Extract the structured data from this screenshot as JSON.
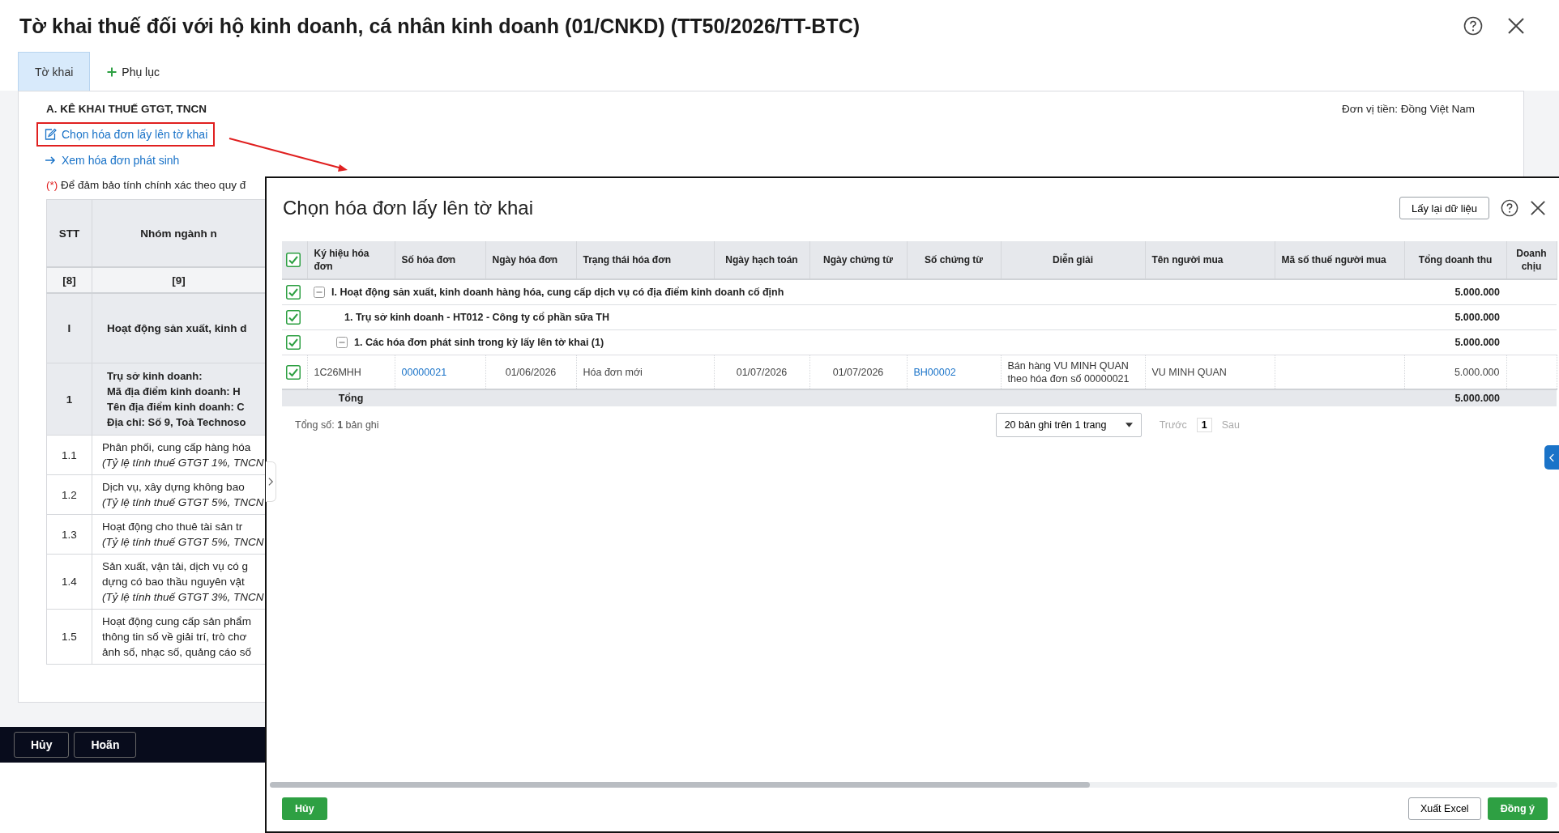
{
  "window": {
    "title": "Tờ khai thuế đối với hộ kinh doanh, cá nhân kinh doanh (01/CNKD) (TT50/2026/TT-BTC)"
  },
  "tabs": [
    {
      "label": "Tờ khai",
      "selected": true,
      "kind": "plain"
    },
    {
      "label": "Phụ lục",
      "selected": false,
      "kind": "add"
    }
  ],
  "section": {
    "heading": "A. KÊ KHAI THUẾ GTGT, TNCN",
    "currency": "Đơn vị tiền: Đồng Việt Nam",
    "links": [
      {
        "label": "Chọn hóa đơn lấy lên tờ khai",
        "kind": "edit",
        "highlighted": true
      },
      {
        "label": "Xem hóa đơn phát sinh",
        "kind": "arrow",
        "highlighted": false
      }
    ],
    "note_mark": "(*)",
    "note": "Để đảm bảo tính chính xác theo quy đ"
  },
  "declaration_table": {
    "columns": [
      "STT",
      "Nhóm ngành n"
    ],
    "index_row": [
      "[8]",
      "[9]"
    ],
    "rows": [
      {
        "kind": "group",
        "stt": "I",
        "lines": [
          "Hoạt động sản xuất, kinh d"
        ]
      },
      {
        "kind": "site",
        "stt": "1",
        "lines": [
          "Trụ sở kinh doanh:",
          "Mã địa điểm kinh doanh: H",
          "Tên địa điểm kinh doanh: C",
          "Địa chỉ: Số 9, Toà Technoso"
        ]
      },
      {
        "kind": "item",
        "stt": "1.1",
        "lines": [
          "Phân phối, cung cấp hàng hóa"
        ],
        "rate": "(Tỷ lệ tính thuế GTGT 1%, TNCN"
      },
      {
        "kind": "item",
        "stt": "1.2",
        "lines": [
          "Dịch vụ, xây dựng không bao"
        ],
        "rate": "(Tỷ lệ tính thuế GTGT 5%, TNCN"
      },
      {
        "kind": "item",
        "stt": "1.3",
        "lines": [
          "Hoạt động cho thuê tài sản tr"
        ],
        "rate": "(Tỷ lệ tính thuế GTGT 5%, TNCN"
      },
      {
        "kind": "item",
        "stt": "1.4",
        "lines": [
          "Sản xuất, vận tải, dịch vụ có g",
          "dựng có bao thầu nguyên vật"
        ],
        "rate": "(Tỷ lệ tính thuế GTGT 3%, TNCN"
      },
      {
        "kind": "item",
        "stt": "1.5",
        "lines": [
          "Hoạt động cung cấp sản phẩm",
          "thông tin số về giải trí, trò chơ",
          "ảnh số, nhạc số, quảng cáo số"
        ]
      }
    ]
  },
  "footer_buttons": [
    "Hủy",
    "Hoãn"
  ],
  "dialog": {
    "title": "Chọn hóa đơn lấy lên tờ khai",
    "refresh_button": "Lấy lại dữ liệu",
    "all_checked": true,
    "columns": [
      "Ký hiệu hóa đơn",
      "Số hóa đơn",
      "Ngày hóa đơn",
      "Trạng thái hóa đơn",
      "Ngày hạch toán",
      "Ngày chứng từ",
      "Số chứng từ",
      "Diễn giải",
      "Tên người mua",
      "Mã số thuế người mua",
      "Tổng doanh thu",
      "Doanh chịu"
    ],
    "rows": [
      {
        "kind": "group",
        "checked": true,
        "expanded": true,
        "label": "I. Hoạt động sản xuất, kinh doanh hàng hóa, cung cấp dịch vụ có địa điểm kinh doanh cố định",
        "total_revenue": "5.000.000",
        "children": [
          {
            "kind": "group",
            "checked": true,
            "label": "1. Trụ sở kinh doanh - HT012 - Công ty cổ phần sữa TH",
            "total_revenue": "5.000.000",
            "children": [
              {
                "kind": "group",
                "checked": true,
                "expanded": true,
                "label": "1. Các hóa đơn phát sinh trong kỳ lấy lên tờ khai (1)",
                "total_revenue": "5.000.000",
                "children": [
                  {
                    "kind": "invoice",
                    "checked": true,
                    "symbol": "1C26MHH",
                    "number": "00000021",
                    "invoice_date": "01/06/2026",
                    "status": "Hóa đơn mới",
                    "posting_date": "01/07/2026",
                    "voucher_date": "01/07/2026",
                    "voucher_no": "BH00002",
                    "description": "Bán hàng VU MINH QUAN theo hóa đơn số 00000021",
                    "buyer_name": "VU MINH QUAN",
                    "total_revenue": "5.000.000"
                  }
                ]
              }
            ]
          }
        ]
      }
    ],
    "total": {
      "label": "Tổng",
      "total_revenue": "5.000.000"
    },
    "record_count": "Tổng số: **1** bản ghi",
    "pagination": {
      "page_size": "20 bản ghi trên 1 trang",
      "prev": {
        "label": "Trước",
        "disabled": true
      },
      "page": "1",
      "next": {
        "label": "Sau",
        "disabled": true
      }
    },
    "buttons": [
      {
        "label": "Hủy",
        "kind": "primary"
      },
      {
        "label": "Xuất Excel",
        "kind": "secondary"
      },
      {
        "label": "Đồng ý",
        "kind": "primary"
      }
    ]
  }
}
